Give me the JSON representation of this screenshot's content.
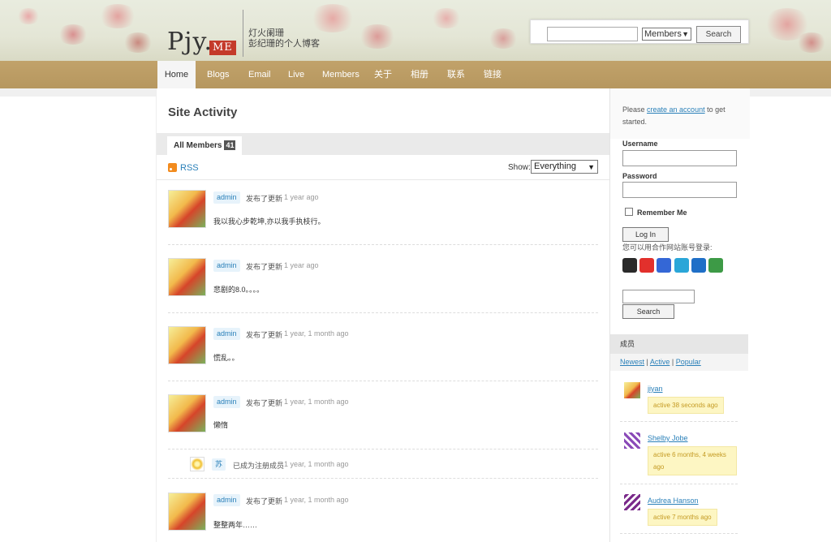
{
  "header": {
    "logo_text": "Pjy.",
    "logo_badge": "ME",
    "tagline_1": "灯火阑珊",
    "tagline_2": "彭纪珊的个人博客",
    "search_placeholder": "",
    "search_scope": "Members",
    "search_button": "Search"
  },
  "nav": [
    "Home",
    "Blogs",
    "Email",
    "Live",
    "Members",
    "关于",
    "相册",
    "联系",
    "链接"
  ],
  "main": {
    "title": "Site Activity",
    "tab_label": "All Members",
    "tab_count": "41",
    "rss": "RSS",
    "show_label": "Show:",
    "show_value": "Everything",
    "activities": [
      {
        "user": "admin",
        "action": "发布了更新",
        "time": "1 year ago",
        "body": "我以我心步乾坤,亦以我手执枝行。"
      },
      {
        "user": "admin",
        "action": "发布了更新",
        "time": "1 year ago",
        "body": "悲剧的8.0。。。。"
      },
      {
        "user": "admin",
        "action": "发布了更新",
        "time": "1 year, 1 month ago",
        "body": "慌乱。。"
      },
      {
        "user": "admin",
        "action": "发布了更新",
        "time": "1 year, 1 month ago",
        "body": "懒惰"
      },
      {
        "user": "苏",
        "action": "已成为注册成员",
        "time": "1 year, 1 month ago",
        "body": ""
      },
      {
        "user": "admin",
        "action": "发布了更新",
        "time": "1 year, 1 month ago",
        "body": "整整两年……"
      }
    ]
  },
  "sidebar": {
    "intro_prefix": "Please ",
    "intro_link": "create an account",
    "intro_suffix_1": " to get",
    "intro_suffix_2": "started.",
    "username_label": "Username",
    "password_label": "Password",
    "remember_label": "Remember Me",
    "login_button": "Log In",
    "partner_text": "您可以用合作网站账号登录:",
    "search_button": "Search",
    "members_title": "成员",
    "filter_newest": "Newest",
    "filter_active": "Active",
    "filter_popular": "Popular",
    "filter_sep": " | ",
    "members": [
      {
        "name": "jiyan",
        "active": "active 38 seconds ago"
      },
      {
        "name": "Shelby Jobe",
        "active_1": "active 6 months, 4 weeks",
        "active_2": "ago"
      },
      {
        "name": "Audrea Hanson",
        "active": "active 7 months ago"
      }
    ]
  },
  "colors": {
    "nav_bg": "#b99a62",
    "link": "#2a80b9",
    "badge_bg": "#e7f3fb",
    "active_bg": "#fdf6c3"
  }
}
